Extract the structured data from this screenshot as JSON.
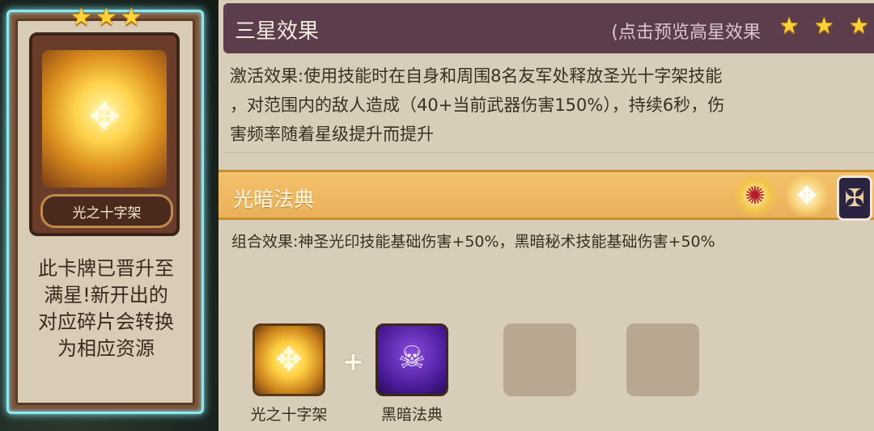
{
  "card": {
    "stars": [
      "★",
      "★",
      "★"
    ],
    "name": "光之十字架",
    "description_lines": [
      "此卡牌已晋升至",
      "满星!新开出的",
      "对应碎片会转换",
      "为相应资源"
    ]
  },
  "header": {
    "title": "三星效果",
    "hint": "(点击预览高星效果",
    "stars": [
      "★",
      "★",
      "★"
    ]
  },
  "effect": {
    "lines": [
      "激活效果:使用技能时在自身和周围8名友军处释放圣光十字架技能",
      "，对范围内的敌人造成（40+当前武器伤害150%），持续6秒，伤",
      "害频率随着星级提升而提升"
    ]
  },
  "combo": {
    "title": "光暗法典",
    "icons": [
      "golden-emblem-icon",
      "holy-cross-icon",
      "dark-tome-icon"
    ],
    "effect": "组合效果:神圣光印技能基础伤害+50%，黑暗秘术技能基础伤害+50%"
  },
  "slots": {
    "items": [
      {
        "label": "光之十字架",
        "icon": "holy-cross-icon"
      },
      {
        "label": "黑暗法典",
        "icon": "dark-tome-icon"
      }
    ],
    "plus": "+"
  },
  "colors": {
    "glow": "#8ee8ef",
    "header_bg": "#5c3d4c",
    "combo_bar": "#eab05a",
    "star": "#ffd23a"
  }
}
